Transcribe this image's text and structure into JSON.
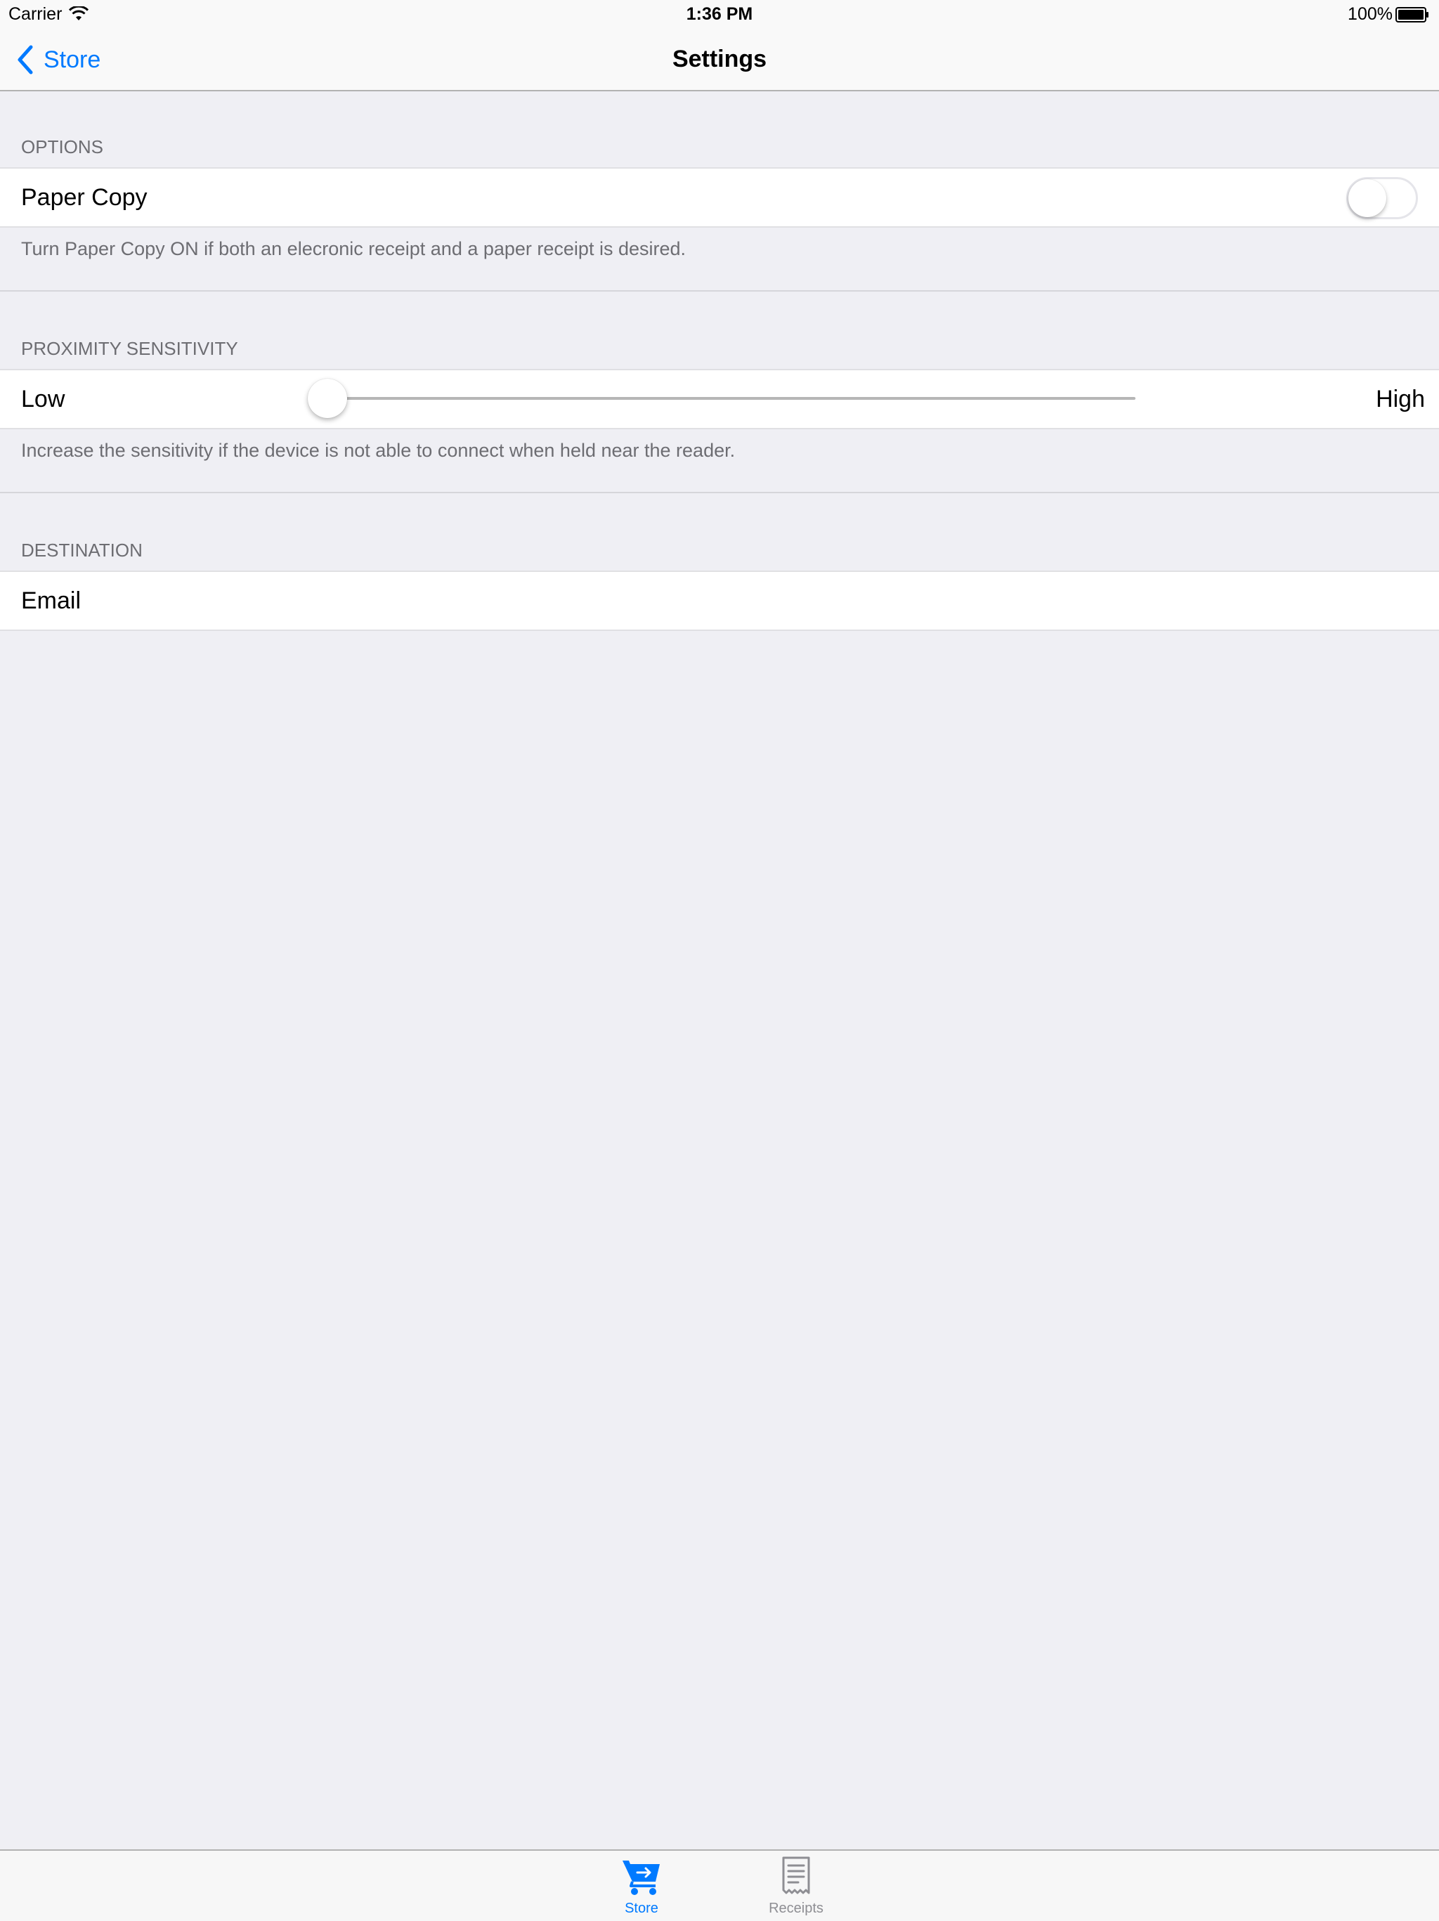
{
  "status_bar": {
    "carrier": "Carrier",
    "time": "1:36 PM",
    "battery": "100%"
  },
  "nav": {
    "back_label": "Store",
    "title": "Settings"
  },
  "options": {
    "header": "OPTIONS",
    "paper_copy_label": "Paper Copy",
    "paper_copy_on": false,
    "footer": "Turn Paper Copy ON if both an elecronic receipt and a paper receipt is desired."
  },
  "proximity": {
    "header": "PROXIMITY SENSITIVITY",
    "min_label": "Low",
    "max_label": "High",
    "value": 0,
    "footer": "Increase the sensitivity if the device is not able to connect when held near the reader."
  },
  "destination": {
    "header": "DESTINATION",
    "email_label": "Email"
  },
  "tabs": [
    {
      "label": "Store",
      "icon": "cart-icon",
      "active": true
    },
    {
      "label": "Receipts",
      "icon": "receipt-icon",
      "active": false
    }
  ],
  "colors": {
    "accent": "#007aff",
    "inactive_tab": "#8e8e93",
    "background": "#efeff4"
  }
}
